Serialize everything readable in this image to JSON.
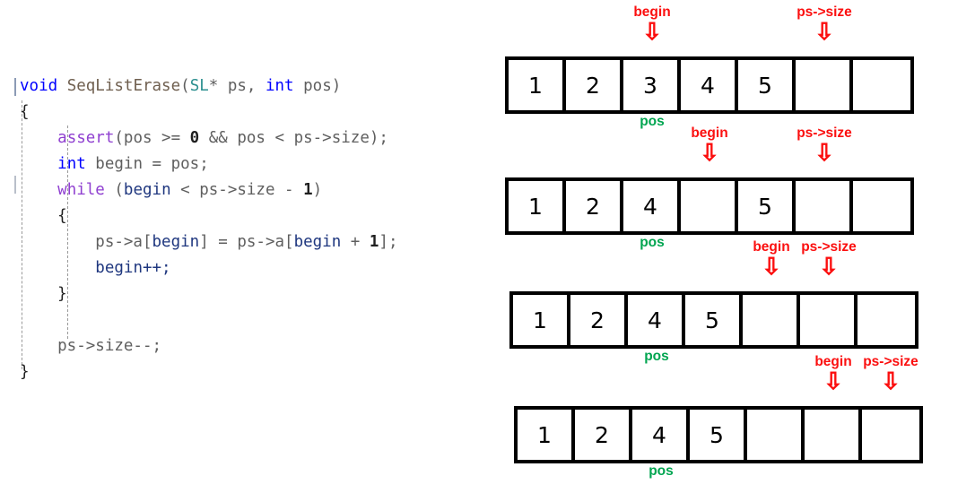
{
  "code": {
    "language": "c",
    "lines": [
      [
        {
          "t": "void",
          "c": "tok-kw"
        },
        {
          "t": " ",
          "c": "tok-plain"
        },
        {
          "t": "SeqListErase",
          "c": "tok-fn"
        },
        {
          "t": "(",
          "c": "tok-plain"
        },
        {
          "t": "SL",
          "c": "tok-type"
        },
        {
          "t": "* ps, ",
          "c": "tok-plain"
        },
        {
          "t": "int",
          "c": "tok-kw"
        },
        {
          "t": " pos)",
          "c": "tok-plain"
        }
      ],
      [
        {
          "t": "{",
          "c": "tok-brace"
        }
      ],
      [
        {
          "t": "    ",
          "c": "tok-plain"
        },
        {
          "t": "assert",
          "c": "tok-ctl"
        },
        {
          "t": "(pos >= ",
          "c": "tok-plain"
        },
        {
          "t": "0",
          "c": "tok-num"
        },
        {
          "t": " && pos < ps->size);",
          "c": "tok-plain"
        }
      ],
      [
        {
          "t": "    ",
          "c": "tok-plain"
        },
        {
          "t": "int",
          "c": "tok-kw"
        },
        {
          "t": " begin = pos;",
          "c": "tok-plain"
        }
      ],
      [
        {
          "t": "    ",
          "c": "tok-plain"
        },
        {
          "t": "while",
          "c": "tok-ctl"
        },
        {
          "t": " (",
          "c": "tok-plain"
        },
        {
          "t": "begin",
          "c": "tok-var"
        },
        {
          "t": " < ps->size - ",
          "c": "tok-plain"
        },
        {
          "t": "1",
          "c": "tok-num"
        },
        {
          "t": ")",
          "c": "tok-plain"
        }
      ],
      [
        {
          "t": "    ",
          "c": "tok-plain"
        },
        {
          "t": "{",
          "c": "tok-brace"
        }
      ],
      [
        {
          "t": "        ps->a[",
          "c": "tok-plain"
        },
        {
          "t": "begin",
          "c": "tok-var"
        },
        {
          "t": "] = ps->a[",
          "c": "tok-plain"
        },
        {
          "t": "begin",
          "c": "tok-var"
        },
        {
          "t": " + ",
          "c": "tok-plain"
        },
        {
          "t": "1",
          "c": "tok-num"
        },
        {
          "t": "];",
          "c": "tok-plain"
        }
      ],
      [
        {
          "t": "        ",
          "c": "tok-plain"
        },
        {
          "t": "begin",
          "c": "tok-var"
        },
        {
          "t": "++;",
          "c": "tok-var"
        }
      ],
      [
        {
          "t": "    ",
          "c": "tok-plain"
        },
        {
          "t": "}",
          "c": "tok-brace"
        }
      ],
      [
        {
          "t": " ",
          "c": "tok-plain"
        }
      ],
      [
        {
          "t": "    ps->size--;",
          "c": "tok-plain"
        }
      ],
      [
        {
          "t": "}",
          "c": "tok-brace"
        }
      ]
    ],
    "colors": {
      "keyword": "#0000ff",
      "control": "#8f3fd0",
      "type": "#2b8f8f",
      "function": "#6f5f4f",
      "variable": "#1f377f",
      "plain": "#5f5f5f"
    }
  },
  "diagram": {
    "colors": {
      "pointer": "#fb0f0f",
      "pos": "#00a550",
      "cell_border": "#000000"
    },
    "arrow_glyph": "⇩",
    "pos_label": "pos",
    "rows": [
      {
        "name": "step-1-initial",
        "cells": [
          "1",
          "2",
          "3",
          "4",
          "5",
          "",
          ""
        ],
        "pointers": [
          {
            "label": "begin",
            "cell_index": 2
          },
          {
            "label": "ps->size",
            "cell_index": 5
          }
        ],
        "pos_index": 2
      },
      {
        "name": "step-2-after-first-shift",
        "cells": [
          "1",
          "2",
          "4",
          "",
          "5",
          "",
          ""
        ],
        "pointers": [
          {
            "label": "begin",
            "cell_index": 3
          },
          {
            "label": "ps->size",
            "cell_index": 5
          }
        ],
        "pos_index": 2
      },
      {
        "name": "step-3-after-second-shift",
        "cells": [
          "1",
          "2",
          "4",
          "5",
          "",
          "",
          ""
        ],
        "pointers": [
          {
            "label": "begin",
            "cell_index": 4
          },
          {
            "label": "ps->size",
            "cell_index": 5
          }
        ],
        "pos_index": 2
      },
      {
        "name": "step-4-final",
        "cells": [
          "1",
          "2",
          "4",
          "5",
          "",
          "",
          ""
        ],
        "pointers": [
          {
            "label": "begin",
            "cell_index": 5
          },
          {
            "label": "ps->size",
            "cell_index": 6
          }
        ],
        "pos_index": 2
      }
    ]
  }
}
